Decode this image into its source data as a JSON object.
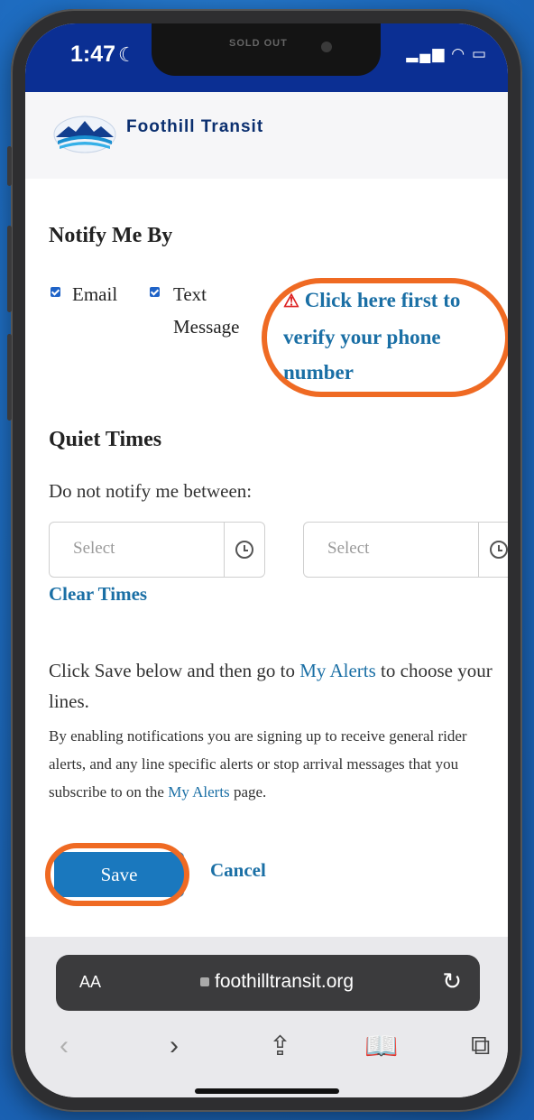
{
  "status": {
    "time": "1:47",
    "notch_text": "SOLD OUT"
  },
  "brand": {
    "name": "Foothill Transit"
  },
  "notify": {
    "heading": "Notify Me By",
    "email_label": "Email",
    "text_label_1": "Text",
    "text_label_2": "Message",
    "verify_line1": "Click here first to",
    "verify_line2": "verify your phone",
    "verify_line3": "number"
  },
  "quiet": {
    "heading": "Quiet Times",
    "subtitle": "Do not notify me between:",
    "start_placeholder": "Select",
    "end_placeholder": "Select",
    "clear_label": "Clear Times"
  },
  "info": {
    "p1_a": "Click Save below and then go to ",
    "p1_link": "My Alerts",
    "p1_b": " to choose your lines.",
    "p2_a": "By enabling notifications you are signing up to receive general rider alerts, and any line specific alerts or stop arrival messages that you subscribe to on the ",
    "p2_link": "My Alerts",
    "p2_b": " page."
  },
  "actions": {
    "save": "Save",
    "cancel": "Cancel"
  },
  "browser": {
    "aa": "AA",
    "url": "foothilltransit.org"
  },
  "colors": {
    "accent": "#1a6fa5",
    "highlight": "#ef6a23",
    "statusbar": "#0b2f93"
  }
}
